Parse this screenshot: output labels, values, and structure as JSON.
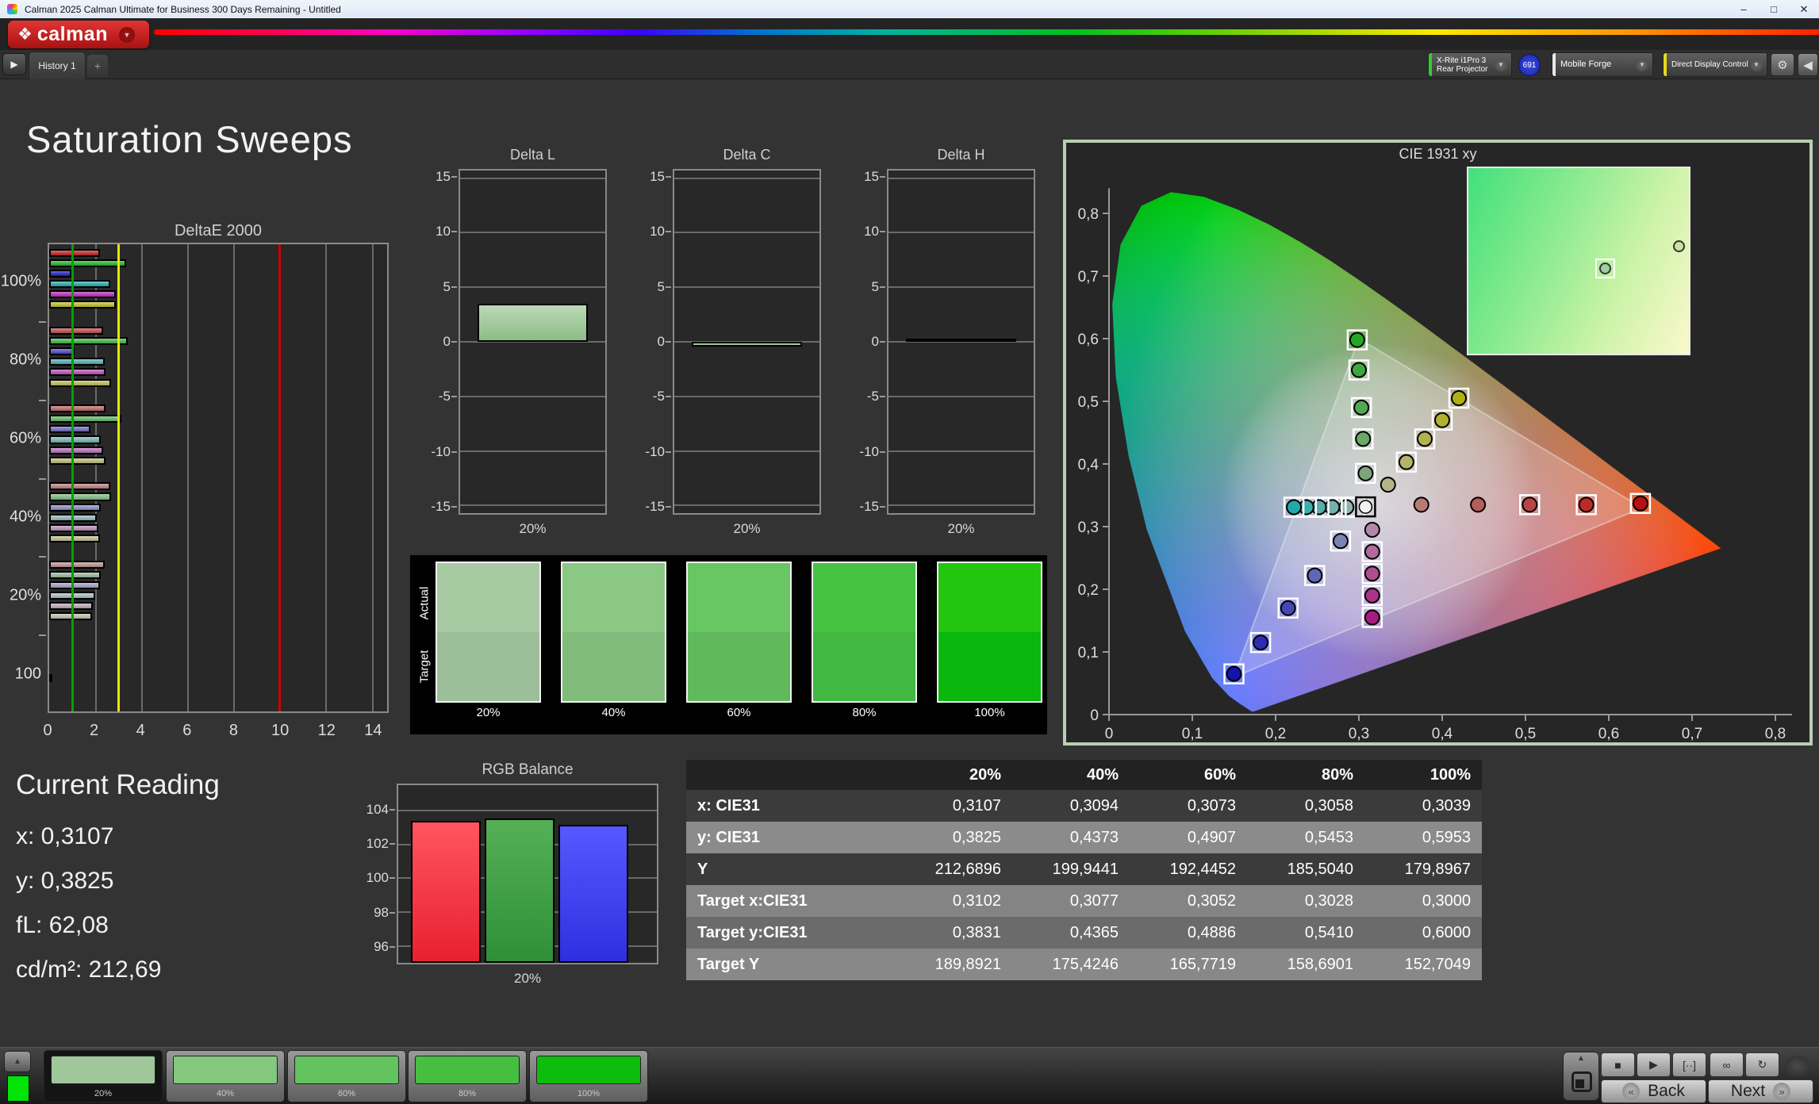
{
  "window": {
    "title": "Calman 2025 Calman Ultimate for Business 300 Days Remaining  - Untitled"
  },
  "brand": {
    "logo_text": "calman"
  },
  "toolbar": {
    "history_tab": "History 1",
    "add_tab": "+",
    "meter": {
      "line1": "X-Rite i1Pro 3",
      "line2": "Rear Projector",
      "badge": "691",
      "edge_color": "#2fd02f"
    },
    "source": {
      "label": "Mobile Forge",
      "edge_color": "#e8e8e8"
    },
    "display_control": {
      "label": "Direct Display Control",
      "edge_color": "#e8d81e"
    }
  },
  "page": {
    "title": "Saturation Sweeps"
  },
  "current_reading": {
    "title": "Current Reading",
    "lines": [
      "x: 0,3107",
      "y: 0,3825",
      "fL: 62,08",
      "cd/m²: 212,69"
    ]
  },
  "measurement_table": {
    "columns": [
      "",
      "20%",
      "40%",
      "60%",
      "80%",
      "100%"
    ],
    "rows": [
      {
        "label": "x: CIE31",
        "values": [
          "0,3107",
          "0,3094",
          "0,3073",
          "0,3058",
          "0,3039"
        ]
      },
      {
        "label": "y: CIE31",
        "values": [
          "0,3825",
          "0,4373",
          "0,4907",
          "0,5453",
          "0,5953"
        ]
      },
      {
        "label": "Y",
        "values": [
          "212,6896",
          "199,9441",
          "192,4452",
          "185,5040",
          "179,8967"
        ]
      },
      {
        "label": "Target x:CIE31",
        "values": [
          "0,3102",
          "0,3077",
          "0,3052",
          "0,3028",
          "0,3000"
        ]
      },
      {
        "label": "Target y:CIE31",
        "values": [
          "0,3831",
          "0,4365",
          "0,4886",
          "0,5410",
          "0,6000"
        ]
      },
      {
        "label": "Target Y",
        "values": [
          "189,8921",
          "175,4246",
          "165,7719",
          "158,6901",
          "152,7049"
        ]
      }
    ]
  },
  "saturation_swatches": {
    "actual_label": "Actual",
    "target_label": "Target",
    "steps": [
      {
        "label": "20%",
        "actual": "#a8caa2",
        "target": "#9cbf99"
      },
      {
        "label": "40%",
        "actual": "#8bc884",
        "target": "#81bc7c"
      },
      {
        "label": "60%",
        "actual": "#68c763",
        "target": "#60ba5c"
      },
      {
        "label": "80%",
        "actual": "#47c342",
        "target": "#40b841"
      },
      {
        "label": "100%",
        "actual": "#23c50e",
        "target": "#0ab80d"
      }
    ]
  },
  "pattern_bar": {
    "quick_swatch_color": "#00e408",
    "items": [
      {
        "label": "20%",
        "color": "#9fc79a",
        "selected": true
      },
      {
        "label": "40%",
        "color": "#84c77e",
        "selected": false
      },
      {
        "label": "60%",
        "color": "#63c35e",
        "selected": false
      },
      {
        "label": "80%",
        "color": "#46bf41",
        "selected": false
      },
      {
        "label": "100%",
        "color": "#0cbd0c",
        "selected": false
      }
    ]
  },
  "transport": {
    "back_label": "Back",
    "next_label": "Next",
    "buttons": [
      "stop-icon",
      "play-icon",
      "measure-icon",
      "continuous-icon",
      "loop-icon"
    ]
  },
  "chart_data": [
    {
      "id": "deltae2000",
      "type": "bar",
      "orientation": "horizontal",
      "title": "DeltaE 2000",
      "xlim": [
        0,
        14.67
      ],
      "xticks": [
        0,
        2,
        4,
        6,
        8,
        10,
        12,
        14
      ],
      "reference_lines": [
        {
          "value": 1,
          "color": "#00a000"
        },
        {
          "value": 3,
          "color": "#e8e800"
        },
        {
          "value": 10,
          "color": "#cc0000"
        }
      ],
      "groups": [
        {
          "label": "100%",
          "values": [
            2.2,
            3.35,
            0.95,
            2.65,
            2.9,
            2.9
          ],
          "colors": [
            "#c21f22",
            "#1eb824",
            "#1c1ac8",
            "#26adad",
            "#bc2abc",
            "#c2c22a"
          ]
        },
        {
          "label": "80%",
          "values": [
            2.35,
            3.4,
            1.1,
            2.4,
            2.45,
            2.7
          ],
          "colors": [
            "#c24d4d",
            "#3eba44",
            "#4b48c6",
            "#52b2b2",
            "#bc4fbc",
            "#c0c05c"
          ]
        },
        {
          "label": "60%",
          "values": [
            2.45,
            3.15,
            1.8,
            2.25,
            2.35,
            2.45
          ],
          "colors": [
            "#c26666",
            "#5fbc63",
            "#6e6bc4",
            "#74b8b8",
            "#bc6fbc",
            "#c0c07c"
          ]
        },
        {
          "label": "40%",
          "values": [
            2.65,
            2.7,
            2.25,
            2.05,
            2.15,
            2.2
          ],
          "colors": [
            "#c07f7f",
            "#7fbf83",
            "#8e8cc6",
            "#92bcbc",
            "#bd8dbd",
            "#c0c096"
          ]
        },
        {
          "label": "20%",
          "values": [
            2.4,
            2.25,
            2.2,
            2.0,
            1.9,
            1.85
          ],
          "colors": [
            "#bd9494",
            "#9bbf9e",
            "#a6a4c8",
            "#aac2c2",
            "#bfaabf",
            "#c2c2ac"
          ]
        },
        {
          "label": "100",
          "values": [
            0.12
          ],
          "colors": [
            "#f0f0f0"
          ]
        }
      ]
    },
    {
      "id": "delta_l",
      "type": "bar",
      "title": "Delta L",
      "categories": [
        "20%"
      ],
      "values": [
        3.4
      ],
      "ylim": [
        -15.7,
        15.7
      ],
      "yticks": [
        15,
        10,
        5,
        0,
        -5,
        -10,
        -15
      ],
      "bar_color_top": "#bcd8b6",
      "bar_color_bottom": "#8cbd86"
    },
    {
      "id": "delta_c",
      "type": "bar",
      "title": "Delta C",
      "categories": [
        "20%"
      ],
      "values": [
        -0.35
      ],
      "ylim": [
        -15.7,
        15.7
      ],
      "yticks": [
        15,
        10,
        5,
        0,
        -5,
        -10,
        -15
      ],
      "bar_color_top": "#bcd8b6",
      "bar_color_bottom": "#8cbd86"
    },
    {
      "id": "delta_h",
      "type": "bar",
      "title": "Delta H",
      "categories": [
        "20%"
      ],
      "values": [
        0.05
      ],
      "ylim": [
        -15.7,
        15.7
      ],
      "yticks": [
        15,
        10,
        5,
        0,
        -5,
        -10,
        -15
      ],
      "bar_color_top": "#444444",
      "bar_color_bottom": "#222222"
    },
    {
      "id": "rgb_balance",
      "type": "bar",
      "title": "RGB Balance",
      "categories": [
        "20%"
      ],
      "ylim": [
        95.0,
        105.5
      ],
      "yticks": [
        104,
        102,
        100,
        98,
        96
      ],
      "series": [
        {
          "name": "Red",
          "value": 103.4,
          "color_top": "#ff5560",
          "color_bottom": "#e82030"
        },
        {
          "name": "Green",
          "value": 103.55,
          "color_top": "#55b055",
          "color_bottom": "#2f8f38"
        },
        {
          "name": "Blue",
          "value": 103.15,
          "color_top": "#5858ff",
          "color_bottom": "#2f2fe0"
        }
      ]
    },
    {
      "id": "cie1931",
      "type": "scatter",
      "title": "CIE 1931 xy",
      "xlim": [
        0,
        0.85
      ],
      "ylim": [
        0,
        0.88
      ],
      "xticks": [
        0,
        0.1,
        0.2,
        0.3,
        0.4,
        0.5,
        0.6,
        0.7,
        0.8
      ],
      "yticks": [
        0,
        0.1,
        0.2,
        0.3,
        0.4,
        0.5,
        0.6,
        0.7,
        0.8
      ],
      "tick_labels": [
        "0",
        "0,1",
        "0,2",
        "0,3",
        "0,4",
        "0,5",
        "0,6",
        "0,7",
        "0,8"
      ],
      "gamut_triangle": [
        [
          0.64,
          0.33
        ],
        [
          0.3,
          0.6
        ],
        [
          0.15,
          0.06
        ]
      ],
      "white_point": {
        "x": 0.308,
        "y": 0.3315,
        "fill": "#f2f2f2"
      },
      "white_target": {
        "x": 0.2955,
        "y": 0.331
      },
      "sweeps": [
        {
          "name": "red",
          "points": [
            {
              "x": 0.375,
              "y": 0.335,
              "fill": "#b97a76",
              "target": false
            },
            {
              "x": 0.443,
              "y": 0.335,
              "fill": "#b55e5a",
              "target": false
            },
            {
              "x": 0.505,
              "y": 0.335,
              "fill": "#b94444",
              "target": true
            },
            {
              "x": 0.573,
              "y": 0.335,
              "fill": "#bb2a28",
              "target": true
            },
            {
              "x": 0.638,
              "y": 0.337,
              "fill": "#b80f12",
              "target": true
            }
          ]
        },
        {
          "name": "green",
          "points": [
            {
              "x": 0.308,
              "y": 0.385,
              "fill": "#7fa37c",
              "target": true
            },
            {
              "x": 0.305,
              "y": 0.44,
              "fill": "#69a867",
              "target": true
            },
            {
              "x": 0.303,
              "y": 0.49,
              "fill": "#53a951",
              "target": true
            },
            {
              "x": 0.3,
              "y": 0.55,
              "fill": "#3da83c",
              "target": true
            },
            {
              "x": 0.298,
              "y": 0.598,
              "fill": "#23a823",
              "target": true
            }
          ]
        },
        {
          "name": "blue",
          "points": [
            {
              "x": 0.278,
              "y": 0.277,
              "fill": "#7b82b5",
              "target": true
            },
            {
              "x": 0.247,
              "y": 0.222,
              "fill": "#5f66b5",
              "target": true
            },
            {
              "x": 0.215,
              "y": 0.17,
              "fill": "#4547b2",
              "target": true
            },
            {
              "x": 0.182,
              "y": 0.115,
              "fill": "#2b2cae",
              "target": true
            },
            {
              "x": 0.15,
              "y": 0.065,
              "fill": "#1213a8",
              "target": true
            }
          ]
        },
        {
          "name": "cyan",
          "points": [
            {
              "x": 0.285,
              "y": 0.331,
              "fill": "#8fb3b0",
              "target": true
            },
            {
              "x": 0.268,
              "y": 0.331,
              "fill": "#74b0ad",
              "target": true
            },
            {
              "x": 0.252,
              "y": 0.331,
              "fill": "#58aeab",
              "target": true
            },
            {
              "x": 0.237,
              "y": 0.331,
              "fill": "#3dacaa",
              "target": true
            },
            {
              "x": 0.222,
              "y": 0.331,
              "fill": "#22a9a8",
              "target": true
            }
          ]
        },
        {
          "name": "magenta",
          "points": [
            {
              "x": 0.316,
              "y": 0.295,
              "fill": "#b288a8",
              "target": false
            },
            {
              "x": 0.316,
              "y": 0.26,
              "fill": "#b06a9d",
              "target": true
            },
            {
              "x": 0.316,
              "y": 0.225,
              "fill": "#af4f93",
              "target": true
            },
            {
              "x": 0.316,
              "y": 0.19,
              "fill": "#ad3389",
              "target": true
            },
            {
              "x": 0.316,
              "y": 0.155,
              "fill": "#a81a80",
              "target": true
            }
          ]
        },
        {
          "name": "yellow",
          "points": [
            {
              "x": 0.335,
              "y": 0.367,
              "fill": "#b3b388",
              "target": false
            },
            {
              "x": 0.357,
              "y": 0.403,
              "fill": "#b3b36a",
              "target": true
            },
            {
              "x": 0.379,
              "y": 0.44,
              "fill": "#b2b24e",
              "target": true
            },
            {
              "x": 0.4,
              "y": 0.47,
              "fill": "#b1b132",
              "target": true
            },
            {
              "x": 0.42,
              "y": 0.505,
              "fill": "#b0b016",
              "target": true
            }
          ]
        }
      ],
      "inset": {
        "markers": [
          {
            "left": 0.62,
            "top": 0.54,
            "fill": "#9fcf9f",
            "target": true
          },
          {
            "left": 0.955,
            "top": 0.42,
            "fill": "#cfe0a0",
            "target": false
          }
        ]
      }
    }
  ]
}
